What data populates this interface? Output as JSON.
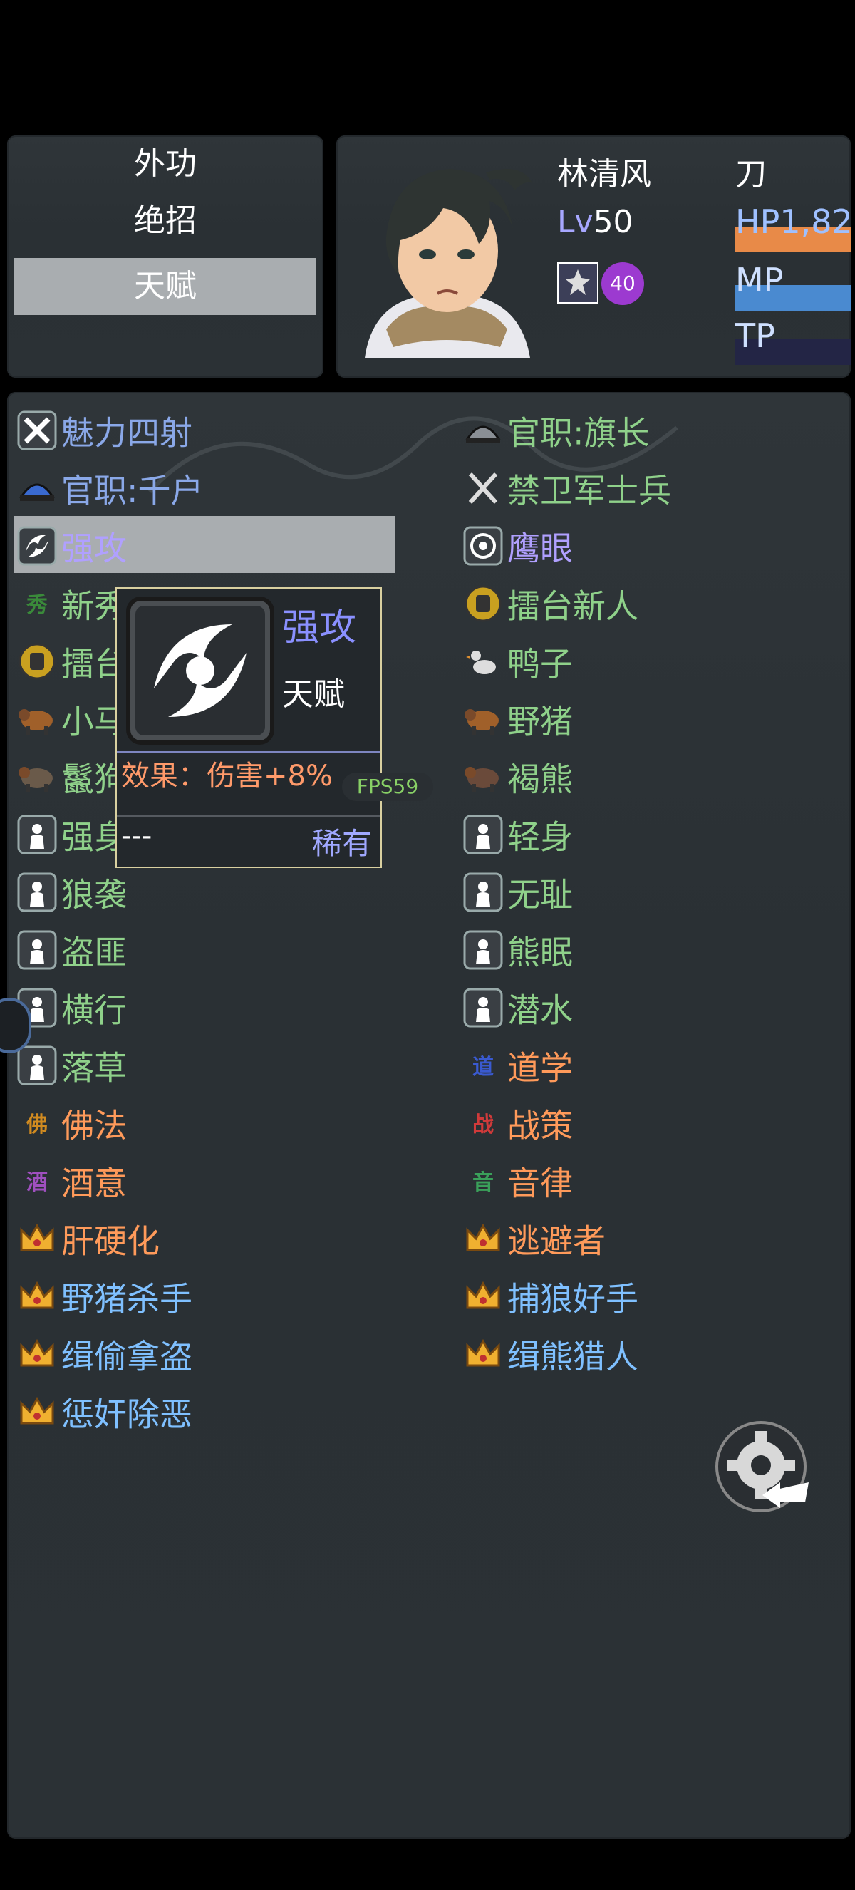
{
  "menu": {
    "items": [
      {
        "label": "外功",
        "selected": false
      },
      {
        "label": "绝招",
        "selected": false
      },
      {
        "label": "天赋",
        "selected": true
      }
    ]
  },
  "character": {
    "name": "林清风",
    "weapon": "刀",
    "level_label": "Lv",
    "level": "50",
    "hp_text": "HP1,82",
    "mp_label": "MP",
    "tp_label": "TP",
    "badge_count": "40",
    "colors": {
      "hp": "#e88a48",
      "mp": "#4a8ad0",
      "tp": "#232545"
    }
  },
  "talents": {
    "left": [
      {
        "name": "魅力四射",
        "icon": "charm-icon",
        "color": "blue"
      },
      {
        "name": "官职:千户",
        "icon": "official-hat-icon",
        "color": "blue"
      },
      {
        "name": "强攻",
        "icon": "power-attack-icon",
        "color": "purple",
        "selected": true
      },
      {
        "name": "新秀",
        "icon": "green-glyph-icon",
        "color": "green"
      },
      {
        "name": "擂台",
        "icon": "fist-icon",
        "color": "green"
      },
      {
        "name": "小马",
        "icon": "horse-icon",
        "color": "green"
      },
      {
        "name": "鬣狗",
        "icon": "hyena-icon",
        "color": "green"
      },
      {
        "name": "强身",
        "icon": "silhouette-icon",
        "color": "green"
      },
      {
        "name": "狼袭",
        "icon": "silhouette-icon",
        "color": "green"
      },
      {
        "name": "盗匪",
        "icon": "silhouette-icon",
        "color": "green"
      },
      {
        "name": "横行",
        "icon": "silhouette-icon",
        "color": "green"
      },
      {
        "name": "落草",
        "icon": "silhouette-icon",
        "color": "green"
      },
      {
        "name": "佛法",
        "icon": "buddha-glyph-icon",
        "color": "orange"
      },
      {
        "name": "酒意",
        "icon": "wine-glyph-icon",
        "color": "orange"
      },
      {
        "name": "肝硬化",
        "icon": "crown-icon",
        "color": "orange"
      },
      {
        "name": "野猪杀手",
        "icon": "crown-icon",
        "color": "lblue"
      },
      {
        "name": "缉偷拿盗",
        "icon": "crown-icon",
        "color": "lblue"
      },
      {
        "name": "惩奸除恶",
        "icon": "crown-icon",
        "color": "lblue"
      }
    ],
    "right": [
      {
        "name": "官职:旗长",
        "icon": "helmet-icon",
        "color": "green"
      },
      {
        "name": "禁卫军士兵",
        "icon": "crossed-swords-icon",
        "color": "green"
      },
      {
        "name": "鹰眼",
        "icon": "eye-icon",
        "color": "purple"
      },
      {
        "name": "擂台新人",
        "icon": "fist-icon",
        "color": "green"
      },
      {
        "name": "鸭子",
        "icon": "duck-icon",
        "color": "green"
      },
      {
        "name": "野猪",
        "icon": "boar-icon",
        "color": "green"
      },
      {
        "name": "褐熊",
        "icon": "bear-icon",
        "color": "green"
      },
      {
        "name": "轻身",
        "icon": "silhouette-icon",
        "color": "green"
      },
      {
        "name": "无耻",
        "icon": "silhouette-icon",
        "color": "green"
      },
      {
        "name": "熊眠",
        "icon": "silhouette-icon",
        "color": "green"
      },
      {
        "name": "潜水",
        "icon": "silhouette-icon",
        "color": "green"
      },
      {
        "name": "道学",
        "icon": "dao-glyph-icon",
        "color": "orange"
      },
      {
        "name": "战策",
        "icon": "war-glyph-icon",
        "color": "orange"
      },
      {
        "name": "音律",
        "icon": "music-glyph-icon",
        "color": "orange"
      },
      {
        "name": "逃避者",
        "icon": "crown-icon",
        "color": "orange"
      },
      {
        "name": "捕狼好手",
        "icon": "crown-icon",
        "color": "lblue"
      },
      {
        "name": "缉熊猎人",
        "icon": "crown-icon",
        "color": "lblue"
      }
    ]
  },
  "tooltip": {
    "name": "强攻",
    "type": "天赋",
    "effect": "效果：伤害+8%",
    "extra": "---",
    "rarity": "稀有"
  },
  "fps": "FPS59"
}
